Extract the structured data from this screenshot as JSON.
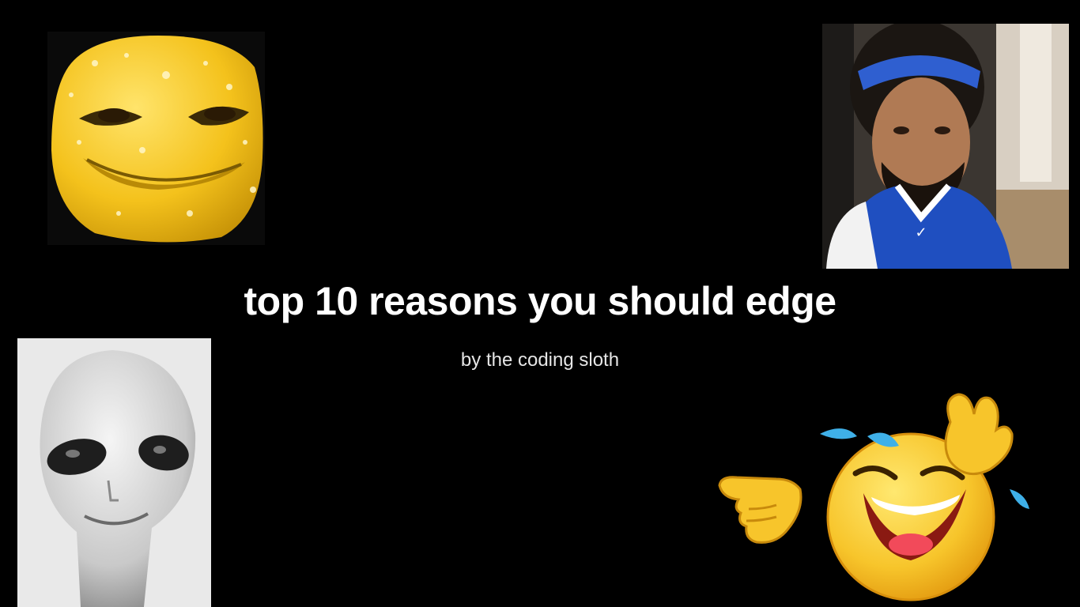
{
  "slide": {
    "title": "top 10 reasons you should edge",
    "subtitle": "by the coding sloth"
  },
  "images": {
    "top_left": "yellow-3d-smiley-face-icon",
    "top_right": "man-photo-icon",
    "bottom_left": "alien-photo-icon",
    "bottom_right": "laughing-emoji-pointing-icon"
  },
  "colors": {
    "background": "#000000",
    "title": "#ffffff",
    "subtitle": "#e6e6e6",
    "emoji_yellow": "#f7c52b",
    "jersey_blue": "#1f4fc0"
  }
}
